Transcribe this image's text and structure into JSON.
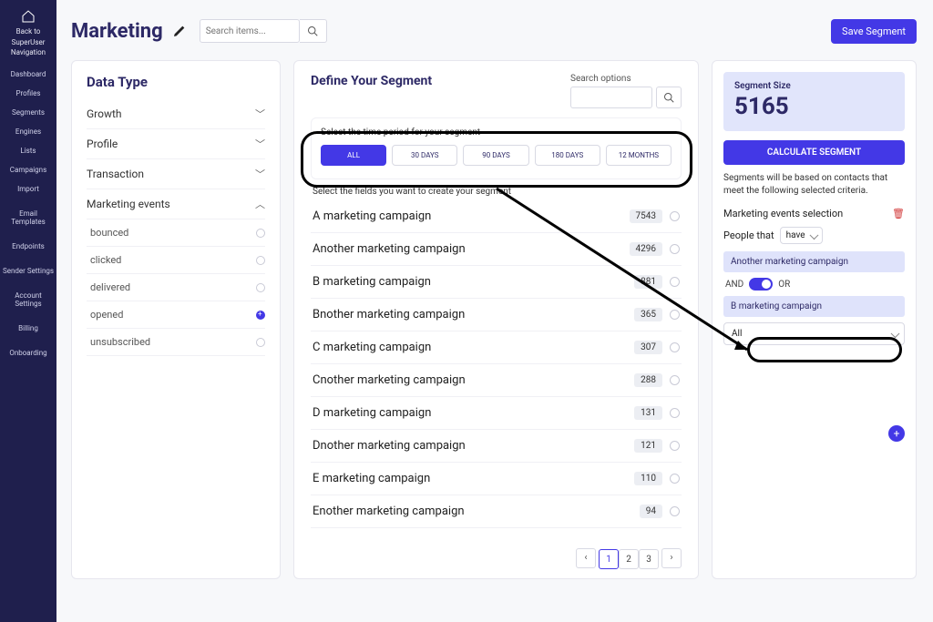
{
  "sidenav": {
    "back_line1": "Back to",
    "back_line2": "SuperUser",
    "back_line3": "Navigation",
    "items": [
      "Dashboard",
      "Profiles",
      "Segments",
      "Engines",
      "Lists",
      "Campaigns",
      "Import",
      "Email Templates",
      "Endpoints",
      "Sender Settings",
      "Account Settings",
      "Billing",
      "Onboarding"
    ]
  },
  "header": {
    "title": "Marketing",
    "search_placeholder": "Search items...",
    "save_label": "Save Segment"
  },
  "left_panel": {
    "title": "Data Type",
    "categories": [
      {
        "label": "Growth",
        "expanded": false
      },
      {
        "label": "Profile",
        "expanded": false
      },
      {
        "label": "Transaction",
        "expanded": false
      },
      {
        "label": "Marketing events",
        "expanded": true
      }
    ],
    "sub_items": [
      {
        "label": "bounced",
        "selected": false
      },
      {
        "label": "clicked",
        "selected": false
      },
      {
        "label": "delivered",
        "selected": false
      },
      {
        "label": "opened",
        "selected": true
      },
      {
        "label": "unsubscribed",
        "selected": false
      }
    ]
  },
  "mid_panel": {
    "title": "Define Your Segment",
    "search_options_label": "Search options",
    "period_label": "Select the time period for your segment",
    "period_buttons": [
      "ALL",
      "30 DAYS",
      "90 DAYS",
      "180 DAYS",
      "12 MONTHS"
    ],
    "period_active": 0,
    "fields_label": "Select the fields you want to create your segment",
    "fields": [
      {
        "name": "A marketing campaign",
        "count": "7543"
      },
      {
        "name": "Another marketing campaign",
        "count": "4296"
      },
      {
        "name": "B marketing campaign",
        "count": "881"
      },
      {
        "name": "Bnother marketing campaign",
        "count": "365"
      },
      {
        "name": "C marketing campaign",
        "count": "307"
      },
      {
        "name": "Cnother marketing campaign",
        "count": "288"
      },
      {
        "name": "D marketing campaign",
        "count": "131"
      },
      {
        "name": "Dnother marketing campaign",
        "count": "121"
      },
      {
        "name": "E marketing campaign",
        "count": "110"
      },
      {
        "name": "Enother marketing campaign",
        "count": "94"
      }
    ],
    "pager": {
      "prev": "‹",
      "pages": [
        "1",
        "2",
        "3"
      ],
      "next": "›",
      "active": 0
    }
  },
  "right_panel": {
    "seg_size_label": "Segment Size",
    "seg_size_value": "5165",
    "calc_label": "CALCULATE SEGMENT",
    "note": "Segments will be based on contacts that meet the following selected criteria.",
    "criteria_title": "Marketing events selection",
    "people_that": "People that",
    "have_label": "have",
    "chip1": "Another marketing campaign",
    "and": "AND",
    "or": "OR",
    "chip2": "B marketing campaign",
    "all_label": "All"
  }
}
